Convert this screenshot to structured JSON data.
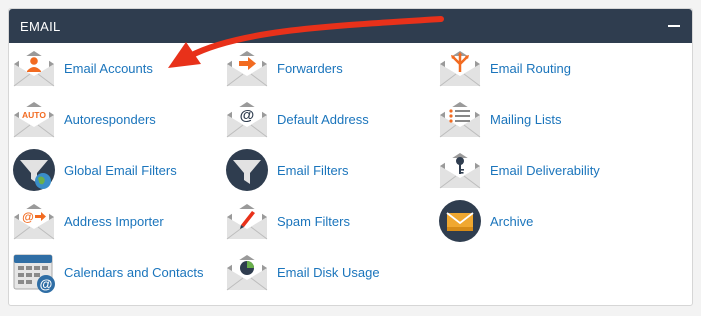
{
  "panel": {
    "title": "EMAIL",
    "collapse_icon": "minus-icon"
  },
  "items": [
    {
      "label": "Email Accounts",
      "icon": "email-accounts-icon"
    },
    {
      "label": "Forwarders",
      "icon": "forwarders-icon"
    },
    {
      "label": "Email Routing",
      "icon": "email-routing-icon"
    },
    {
      "label": "Autoresponders",
      "icon": "autoresponders-icon"
    },
    {
      "label": "Default Address",
      "icon": "default-address-icon"
    },
    {
      "label": "Mailing Lists",
      "icon": "mailing-lists-icon"
    },
    {
      "label": "Global Email Filters",
      "icon": "global-email-filters-icon"
    },
    {
      "label": "Email Filters",
      "icon": "email-filters-icon"
    },
    {
      "label": "Email Deliverability",
      "icon": "email-deliverability-icon"
    },
    {
      "label": "Address Importer",
      "icon": "address-importer-icon"
    },
    {
      "label": "Spam Filters",
      "icon": "spam-filters-icon"
    },
    {
      "label": "Archive",
      "icon": "archive-icon"
    },
    {
      "label": "Calendars and Contacts",
      "icon": "calendars-contacts-icon"
    },
    {
      "label": "Email Disk Usage",
      "icon": "email-disk-usage-icon"
    }
  ],
  "icon_text": {
    "autoresponders": "AUTO",
    "default_address": "@",
    "address_importer": "@",
    "calendars_at": "@"
  },
  "colors": {
    "header_bg": "#2f3d4f",
    "link": "#1b75bc",
    "accent_orange": "#f26b21",
    "annotation_red": "#e8311a"
  }
}
